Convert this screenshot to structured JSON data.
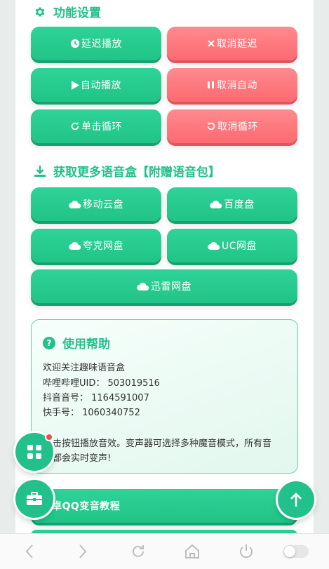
{
  "features": {
    "title": "功能设置",
    "buttons": [
      {
        "label": "延迟播放",
        "icon": "clock-icon"
      },
      {
        "label": "取消延迟",
        "icon": "x-icon"
      },
      {
        "label": "自动播放",
        "icon": "play-icon"
      },
      {
        "label": "取消自动",
        "icon": "pause-icon"
      },
      {
        "label": "单击循环",
        "icon": "redo-icon"
      },
      {
        "label": "取消循环",
        "icon": "undo-icon"
      }
    ]
  },
  "download": {
    "title": "获取更多语音盒【附赠语音包】",
    "buttons": [
      {
        "label": "移动云盘",
        "icon": "cloud-icon"
      },
      {
        "label": "百度盘",
        "icon": "cloud-icon"
      },
      {
        "label": "夸克网盘",
        "icon": "cloud-icon"
      },
      {
        "label": "UC网盘",
        "icon": "cloud-icon"
      },
      {
        "label": "迅雷网盘",
        "icon": "cloud-icon"
      }
    ]
  },
  "help": {
    "title": "使用帮助",
    "icon": "question-icon",
    "lines": [
      "欢迎关注趣味语音盒",
      "哔哩哔哩UID： 503019516",
      "抖音音号： 1164591007",
      "快手号： 1060340752"
    ],
    "desc1": "击按钮播放音效。变声器可选择多种魔音模式，所有音",
    "desc2": "都会实时变声!"
  },
  "tutorial": {
    "label": "卓QQ变音教程"
  },
  "colors": {
    "green": "#22c08a",
    "red": "#fb6a71"
  }
}
